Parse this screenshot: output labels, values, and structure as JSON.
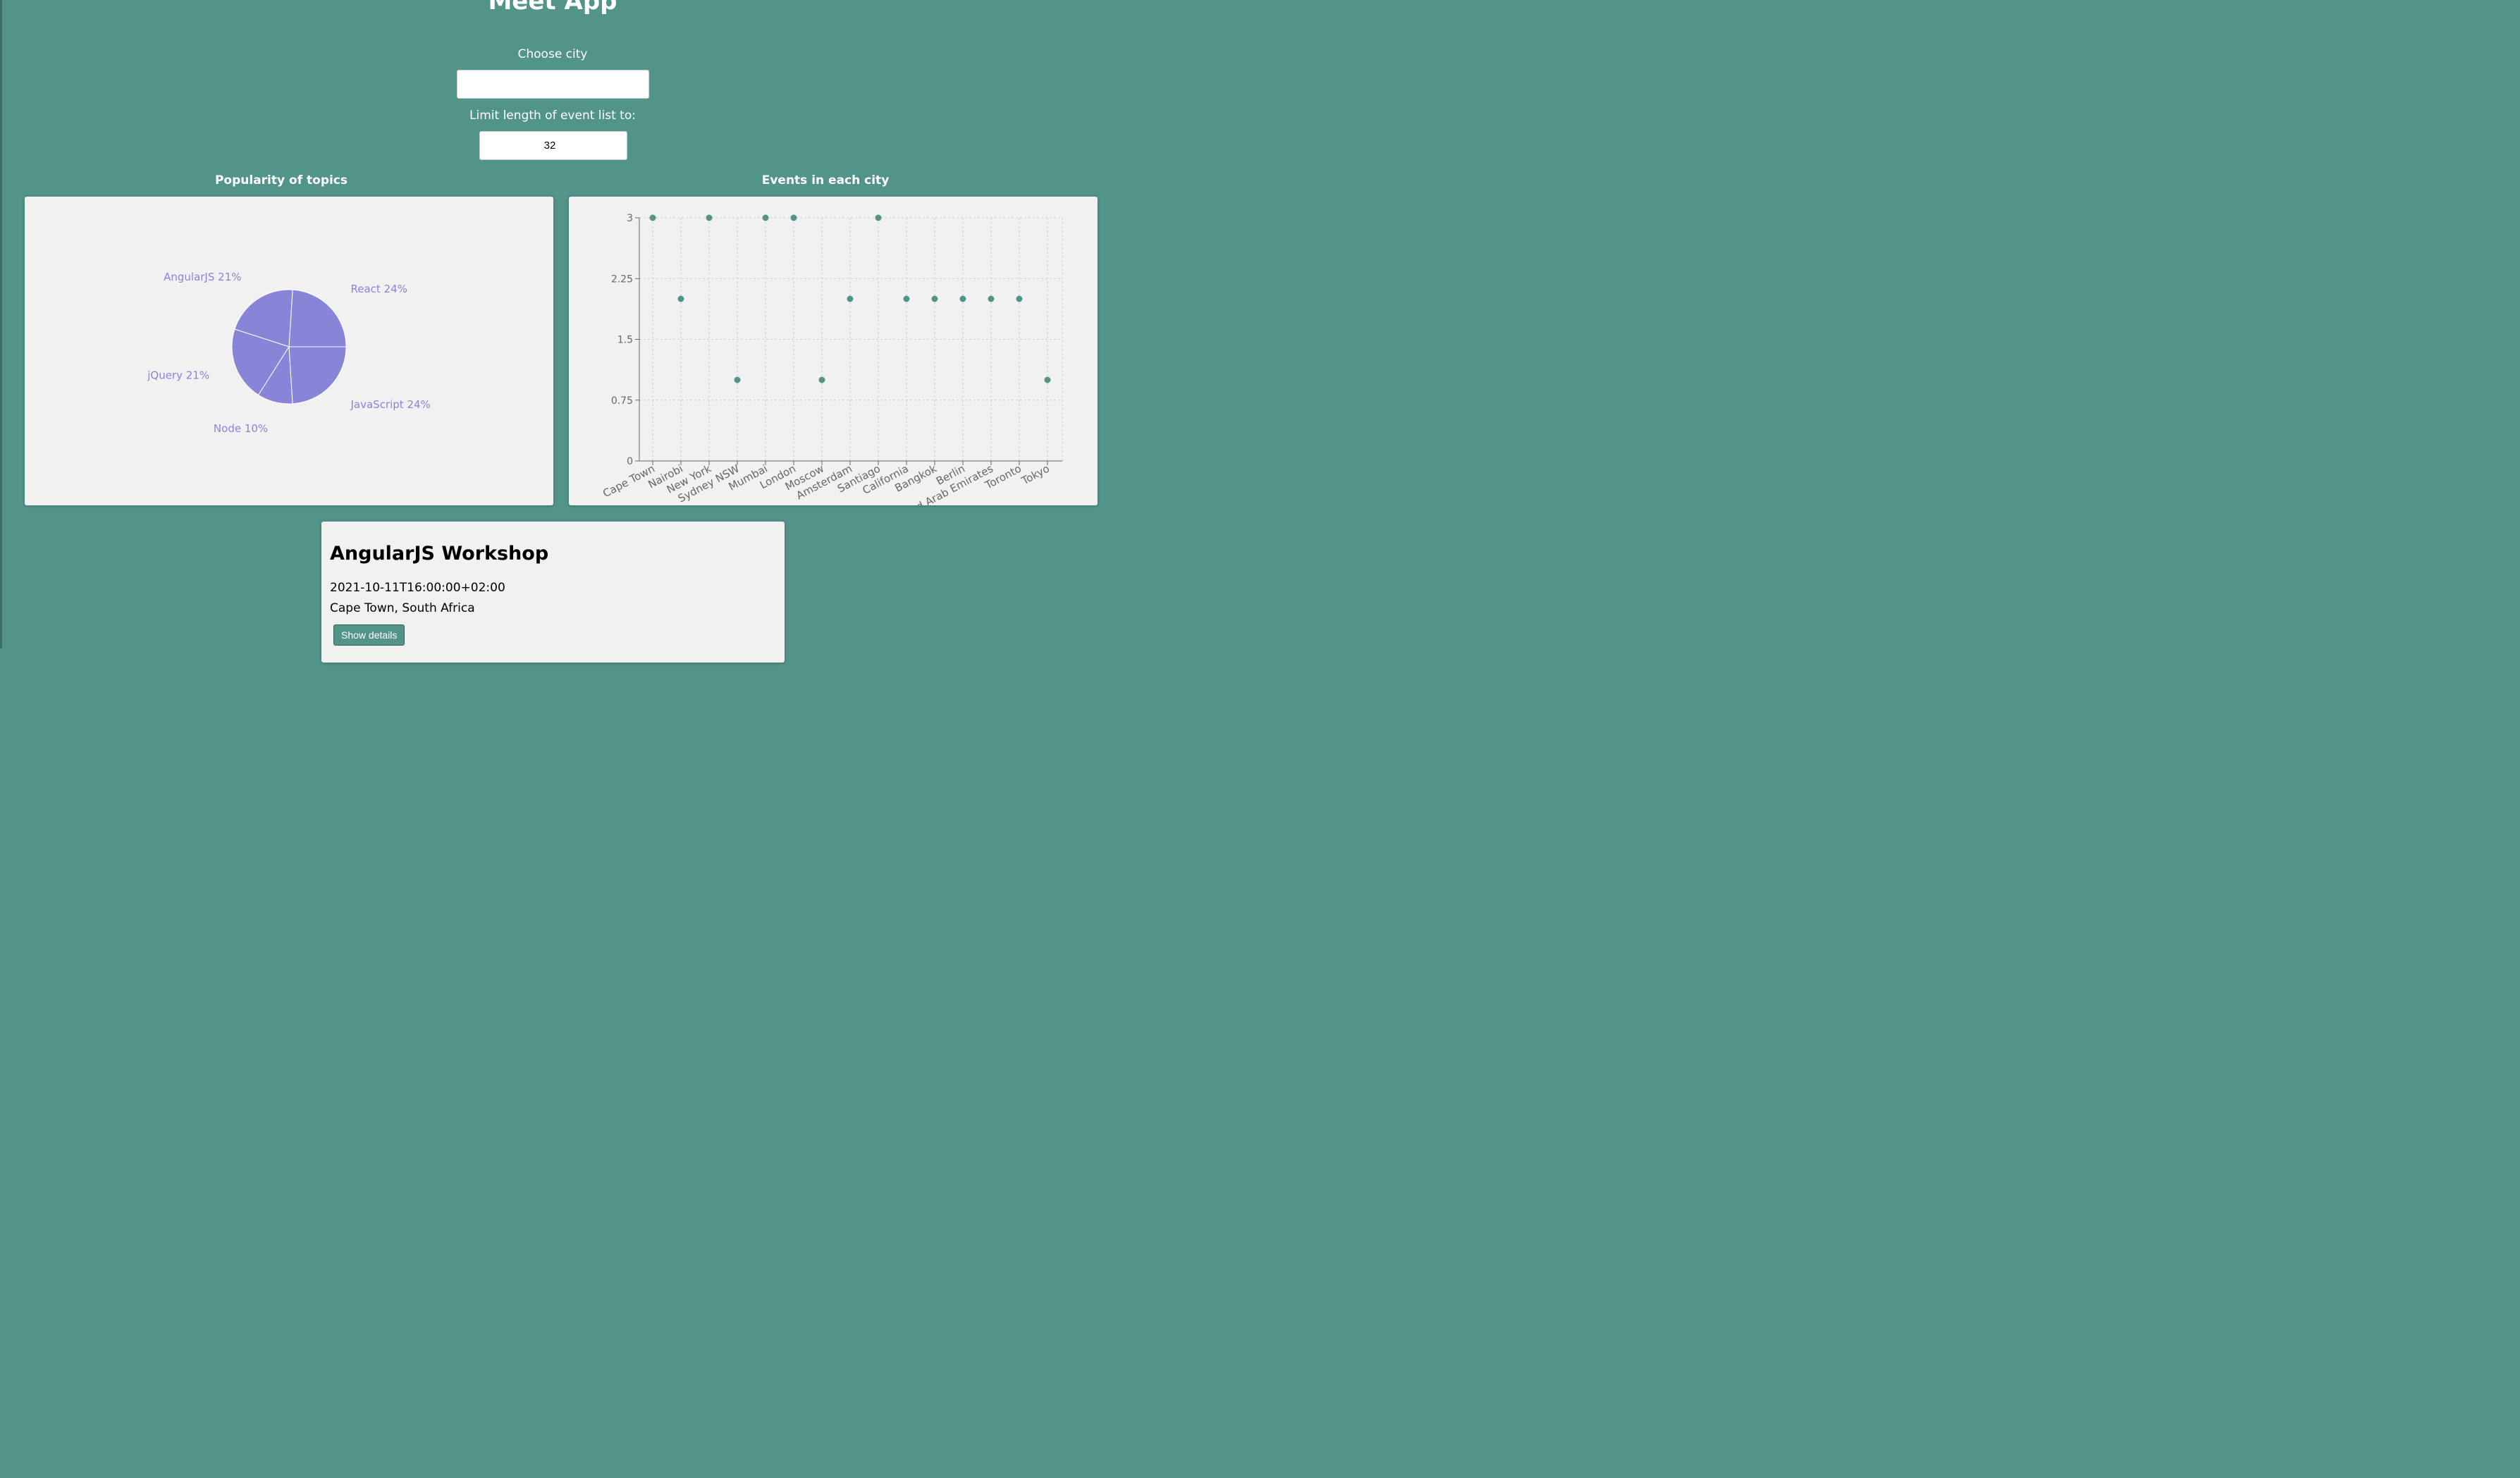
{
  "app": {
    "title": "Meet App"
  },
  "city_search": {
    "label": "Choose city",
    "value": ""
  },
  "event_limit": {
    "label": "Limit length of event list to:",
    "value": "32"
  },
  "charts": {
    "pie_heading": "Popularity of topics",
    "scatter_heading": "Events in each city"
  },
  "chart_data": [
    {
      "type": "pie",
      "title": "Popularity of topics",
      "categories": [
        "React",
        "AngularJS",
        "jQuery",
        "Node",
        "JavaScript"
      ],
      "values": [
        24,
        21,
        21,
        10,
        24
      ],
      "labels": [
        "React 24%",
        "AngularJS 21%",
        "jQuery 21%",
        "Node 10%",
        "JavaScript 24%"
      ],
      "colors": {
        "fill": "#8884d8",
        "label": "#8884d8",
        "stroke": "#ffffff"
      }
    },
    {
      "type": "scatter",
      "title": "Events in each city",
      "categories": [
        "Cape Town",
        "Nairobi",
        "New York",
        "Sydney NSW",
        "Mumbai",
        "London",
        "Moscow",
        "Amsterdam",
        "Santiago",
        "California",
        "Bangkok",
        "Berlin",
        "United Arab Emirates",
        "Toronto",
        "Tokyo"
      ],
      "values": [
        3,
        2,
        3,
        1,
        3,
        3,
        1,
        2,
        3,
        2,
        2,
        2,
        2,
        2,
        1
      ],
      "yticks": [
        "0",
        "0.75",
        "1.5",
        "2.25",
        "3"
      ],
      "ylim": [
        0,
        3
      ],
      "grid": true,
      "colors": {
        "point": "#52938a",
        "grid": "#cccccc",
        "axis": "#666666"
      }
    }
  ],
  "event": {
    "title": "AngularJS Workshop",
    "datetime": "2021-10-11T16:00:00+02:00",
    "location": "Cape Town, South Africa",
    "details_button": "Show details"
  }
}
